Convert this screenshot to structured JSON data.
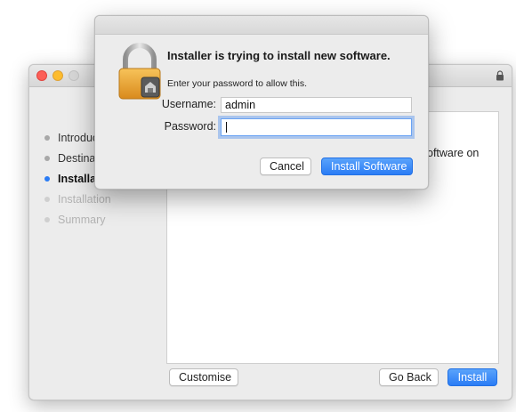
{
  "installer": {
    "steps": [
      {
        "label": "Introduc",
        "state": "done"
      },
      {
        "label": "Destinat",
        "state": "done"
      },
      {
        "label": "Installat",
        "state": "active"
      },
      {
        "label": "Installation",
        "state": "todo"
      },
      {
        "label": "Summary",
        "state": "todo"
      }
    ],
    "content_fragment": "oftware on",
    "buttons": {
      "customise": "Customise",
      "go_back": "Go Back",
      "install": "Install"
    },
    "icons": {
      "titlebar_lock": "lock-icon"
    }
  },
  "auth_dialog": {
    "title": "Installer is trying to install new software.",
    "subtitle": "Enter your password to allow this.",
    "username_label": "Username:",
    "username_value": "admin",
    "password_label": "Password:",
    "password_value": "",
    "cancel_label": "Cancel",
    "confirm_label": "Install Software",
    "icon": "padlock-icon"
  },
  "colors": {
    "accent": "#2a7cf5",
    "close": "#fc5f57",
    "minimize": "#fdbc2e"
  }
}
